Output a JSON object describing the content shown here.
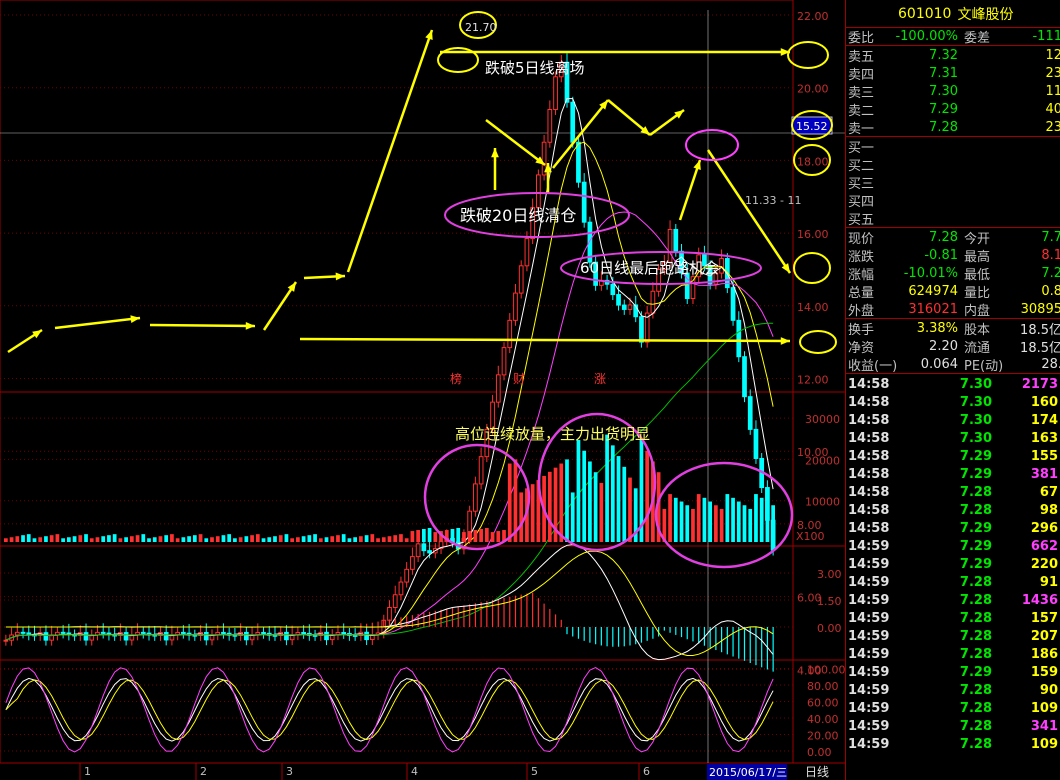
{
  "stock": {
    "code": "601010",
    "name": "文峰股份"
  },
  "axis": {
    "price_ticks": [
      "22.00",
      "20.00",
      "18.00",
      "16.00",
      "14.00",
      "12.00",
      "10.00",
      "8.00",
      "6.00",
      "4.00"
    ],
    "current_price_marker": "15.52",
    "volume_ticks": [
      "30000",
      "20000",
      "10000"
    ],
    "volume_unit": "X100",
    "macd_ticks": [
      "3.00",
      "1.50",
      "0.00"
    ],
    "kdj_ticks": [
      "100.00",
      "80.00",
      "60.00",
      "40.00",
      "20.00",
      "0.00"
    ],
    "month_labels": [
      "1",
      "2",
      "3",
      "4",
      "5",
      "6"
    ],
    "cursor_date": "2015/06/17/三",
    "period_label": "日线",
    "peak_label": "21.70",
    "cursor_value_label": "11.33 - 11"
  },
  "event_tags": [
    "榜",
    "财",
    "涨"
  ],
  "annotations": {
    "break_5day": "跌破5日线离场",
    "break_20day": "跌破20日线清仓",
    "last_chance_60day": "60日线最后跑路机会",
    "high_volume": "高位连续放量，主力出货明显"
  },
  "order_book": {
    "ratio_label": "委比",
    "ratio_value": "-100.00%",
    "diff_label": "委差",
    "diff_value": "-111",
    "asks": [
      {
        "label": "卖五",
        "price": "7.32",
        "vol": "12"
      },
      {
        "label": "卖四",
        "price": "7.31",
        "vol": "23"
      },
      {
        "label": "卖三",
        "price": "7.30",
        "vol": "11"
      },
      {
        "label": "卖二",
        "price": "7.29",
        "vol": "40"
      },
      {
        "label": "卖一",
        "price": "7.28",
        "vol": "23"
      }
    ],
    "bids": [
      {
        "label": "买一"
      },
      {
        "label": "买二"
      },
      {
        "label": "买三"
      },
      {
        "label": "买四"
      },
      {
        "label": "买五"
      }
    ]
  },
  "quote": {
    "rows": [
      {
        "l1": "现价",
        "v1": "7.28",
        "l2": "今开",
        "v2": "7.7",
        "c1": "green",
        "c2": "green"
      },
      {
        "l1": "涨跌",
        "v1": "-0.81",
        "l2": "最高",
        "v2": "8.1",
        "c1": "green",
        "c2": "red"
      },
      {
        "l1": "涨幅",
        "v1": "-10.01%",
        "l2": "最低",
        "v2": "7.2",
        "c1": "green",
        "c2": "green"
      },
      {
        "l1": "总量",
        "v1": "624974",
        "l2": "量比",
        "v2": "0.8",
        "c1": "yellow",
        "c2": "yellow"
      },
      {
        "l1": "外盘",
        "v1": "316021",
        "l2": "内盘",
        "v2": "30895",
        "c1": "red",
        "c2": "yellow"
      }
    ],
    "rows2": [
      {
        "l1": "换手",
        "v1": "3.38%",
        "l2": "股本",
        "v2": "18.5亿",
        "c1": "yellow",
        "c2": "white"
      },
      {
        "l1": "净资",
        "v1": "2.20",
        "l2": "流通",
        "v2": "18.5亿",
        "c1": "white",
        "c2": "white"
      },
      {
        "l1": "收益(一)",
        "v1": "0.064",
        "l2": "PE(动)",
        "v2": "28.",
        "c1": "white",
        "c2": "white"
      }
    ]
  },
  "ticks": [
    {
      "t": "14:58",
      "p": "7.30",
      "v": "2173",
      "mg": true
    },
    {
      "t": "14:58",
      "p": "7.30",
      "v": "160",
      "mg": false
    },
    {
      "t": "14:58",
      "p": "7.30",
      "v": "174",
      "mg": false
    },
    {
      "t": "14:58",
      "p": "7.30",
      "v": "163",
      "mg": false
    },
    {
      "t": "14:58",
      "p": "7.29",
      "v": "155",
      "mg": false
    },
    {
      "t": "14:58",
      "p": "7.29",
      "v": "381",
      "mg": true
    },
    {
      "t": "14:58",
      "p": "7.28",
      "v": "67",
      "mg": false
    },
    {
      "t": "14:58",
      "p": "7.28",
      "v": "98",
      "mg": false
    },
    {
      "t": "14:58",
      "p": "7.29",
      "v": "296",
      "mg": false
    },
    {
      "t": "14:59",
      "p": "7.29",
      "v": "662",
      "mg": true
    },
    {
      "t": "14:59",
      "p": "7.29",
      "v": "220",
      "mg": false
    },
    {
      "t": "14:59",
      "p": "7.28",
      "v": "91",
      "mg": false
    },
    {
      "t": "14:59",
      "p": "7.28",
      "v": "1436",
      "mg": true
    },
    {
      "t": "14:59",
      "p": "7.28",
      "v": "157",
      "mg": false
    },
    {
      "t": "14:59",
      "p": "7.28",
      "v": "207",
      "mg": false
    },
    {
      "t": "14:59",
      "p": "7.28",
      "v": "186",
      "mg": false
    },
    {
      "t": "14:59",
      "p": "7.29",
      "v": "159",
      "mg": false
    },
    {
      "t": "14:59",
      "p": "7.28",
      "v": "90",
      "mg": false
    },
    {
      "t": "14:59",
      "p": "7.28",
      "v": "109",
      "mg": false
    },
    {
      "t": "14:59",
      "p": "7.28",
      "v": "341",
      "mg": true
    },
    {
      "t": "14:59",
      "p": "7.28",
      "v": "109",
      "mg": false
    }
  ],
  "colors": {
    "up": "#ff3030",
    "down": "#00ffff",
    "ma5": "#ffffff",
    "ma10": "#ffff00",
    "ma20": "#ff40ff",
    "ma60": "#00c000",
    "annotation": "#ffff00",
    "circle": "#e040e0",
    "frame": "#a00000"
  }
}
